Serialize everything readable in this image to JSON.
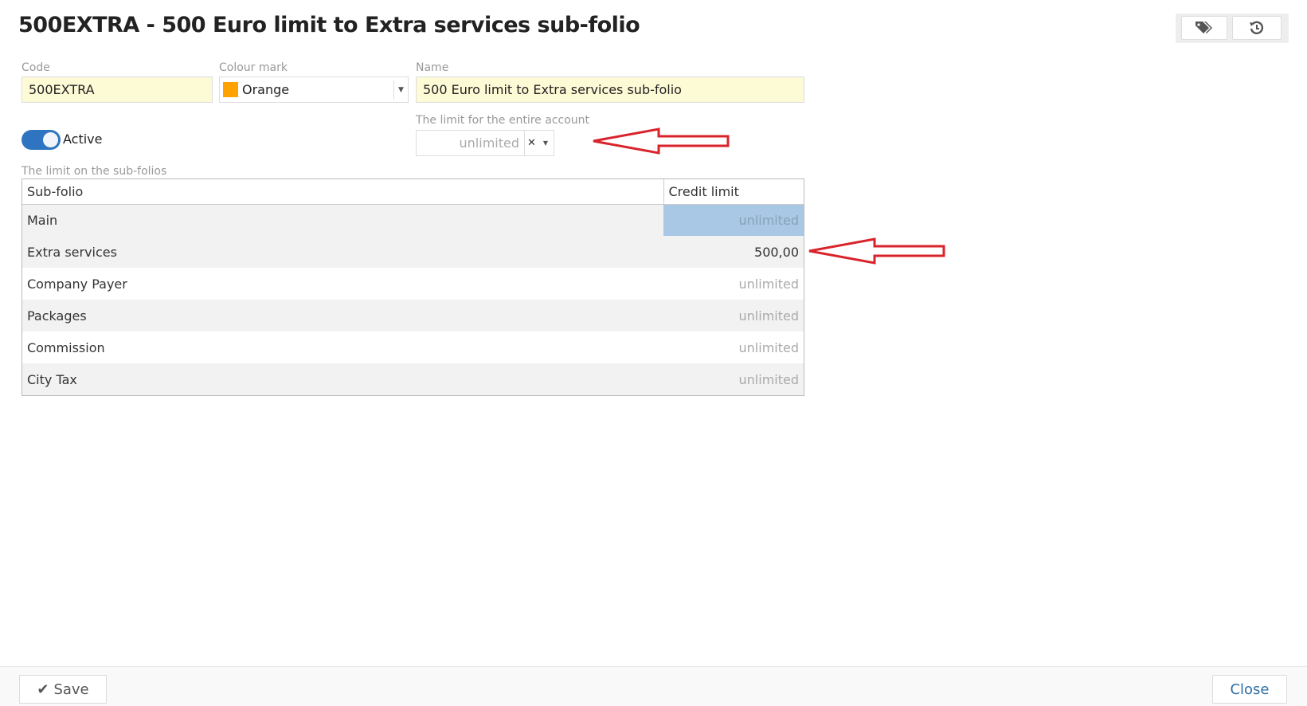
{
  "title": "500EXTRA - 500 Euro limit to Extra services sub-folio",
  "toolbar": {
    "tags_icon": "tags-icon",
    "history_icon": "history-icon"
  },
  "form": {
    "code_label": "Code",
    "code_value": "500EXTRA",
    "colour_label": "Colour mark",
    "colour_value": "Orange",
    "colour_hex": "#ffa200",
    "name_label": "Name",
    "name_value": "500 Euro limit to Extra services sub-folio",
    "active_label": "Active",
    "active": true,
    "limit_label": "The limit for the entire account",
    "limit_placeholder": "unlimited",
    "clear_symbol": "✕"
  },
  "subfolios": {
    "label": "The limit on the sub-folios",
    "columns": [
      "Sub-folio",
      "Credit limit"
    ],
    "rows": [
      {
        "name": "Main",
        "limit": "unlimited"
      },
      {
        "name": "Extra services",
        "limit": "500,00"
      },
      {
        "name": "Company Payer",
        "limit": "unlimited"
      },
      {
        "name": "Packages",
        "limit": "unlimited"
      },
      {
        "name": "Commission",
        "limit": "unlimited"
      },
      {
        "name": "City Tax",
        "limit": "unlimited"
      }
    ]
  },
  "footer": {
    "save_label": "Save",
    "close_label": "Close"
  },
  "colors": {
    "accent": "#2f74c0",
    "arrow": "#d9232a",
    "selected_cell": "#a8c8e6"
  }
}
